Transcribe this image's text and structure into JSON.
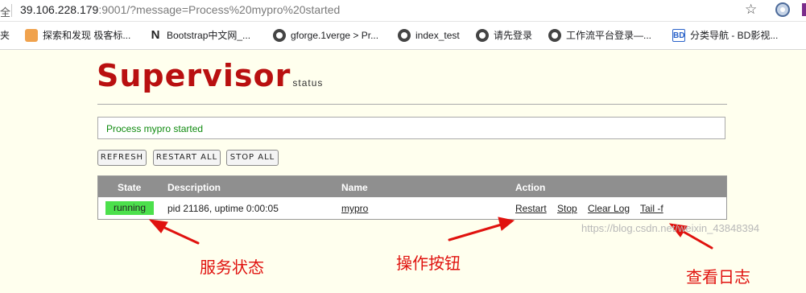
{
  "browser": {
    "lock_glyph": "全",
    "url_host": "39.106.228.179",
    "url_rest": ":9001/?message=Process%20mypro%20started"
  },
  "bookmarks": [
    {
      "label": "夹",
      "icon": "none"
    },
    {
      "label": "探索和发现 极客标...",
      "icon": "book-icon"
    },
    {
      "label": "Bootstrap中文网_...",
      "icon": "n-icon"
    },
    {
      "label": "gforge.1verge > Pr...",
      "icon": "globe-icon"
    },
    {
      "label": "index_test",
      "icon": "globe-icon"
    },
    {
      "label": "请先登录",
      "icon": "globe-icon"
    },
    {
      "label": "工作流平台登录—...",
      "icon": "globe-icon"
    },
    {
      "label": "分类导航 - BD影视...",
      "icon": "bd-icon"
    }
  ],
  "supervisor": {
    "logo": "Supervisor",
    "logo_sub": "status",
    "message": "Process mypro started",
    "buttons": {
      "refresh": "REFRESH",
      "restart_all": "RESTART ALL",
      "stop_all": "STOP ALL"
    },
    "table": {
      "headers": {
        "state": "State",
        "description": "Description",
        "name": "Name",
        "action": "Action"
      },
      "row": {
        "state": "running",
        "description": "pid 21186, uptime 0:00:05",
        "name": "mypro",
        "actions": {
          "restart": "Restart",
          "stop": "Stop",
          "clear_log": "Clear Log",
          "tail": "Tail -f"
        }
      }
    }
  },
  "annotations": {
    "service_state": "服务状态",
    "operation_buttons": "操作按钮",
    "view_log": "查看日志",
    "color": "#e0120e"
  },
  "watermark": "https://blog.csdn.net/weixin_43848394",
  "colors": {
    "logo_red": "#b91010",
    "page_bg": "#ffffee",
    "running_green": "#4ce04c",
    "message_green": "#0e8a0e",
    "header_gray": "#8f8f8f"
  }
}
